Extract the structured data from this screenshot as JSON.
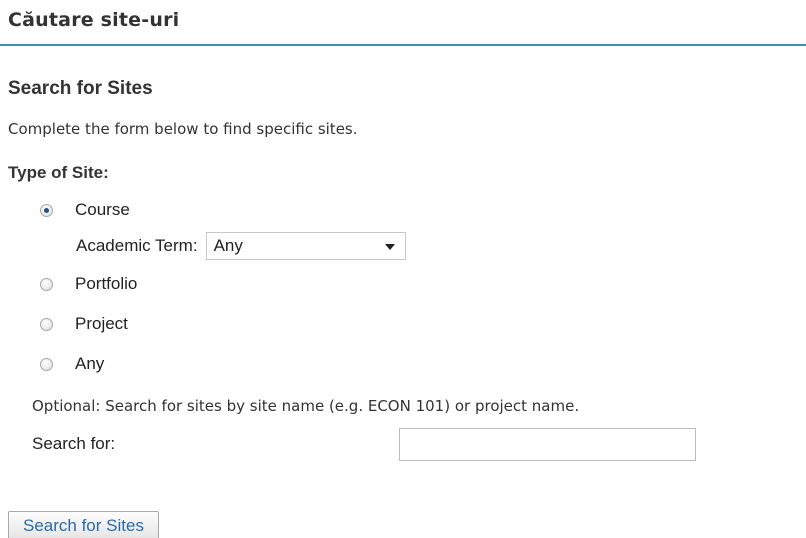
{
  "page": {
    "title": "Căutare site-uri"
  },
  "form": {
    "heading": "Search for Sites",
    "instruction": "Complete the form below to find specific sites.",
    "type_label": "Type of Site:",
    "site_types": [
      {
        "label": "Course",
        "checked": true
      },
      {
        "label": "Portfolio",
        "checked": false
      },
      {
        "label": "Project",
        "checked": false
      },
      {
        "label": "Any",
        "checked": false
      }
    ],
    "academic_term": {
      "label": "Academic Term:",
      "selected": "Any"
    },
    "optional_text": "Optional: Search for sites by site name (e.g. ECON 101) or project name.",
    "search_label": "Search for:",
    "search_value": "",
    "submit_label": "Search for Sites"
  },
  "colors": {
    "header_rule": "#3b8fb8",
    "button_text": "#2a6aa8"
  }
}
